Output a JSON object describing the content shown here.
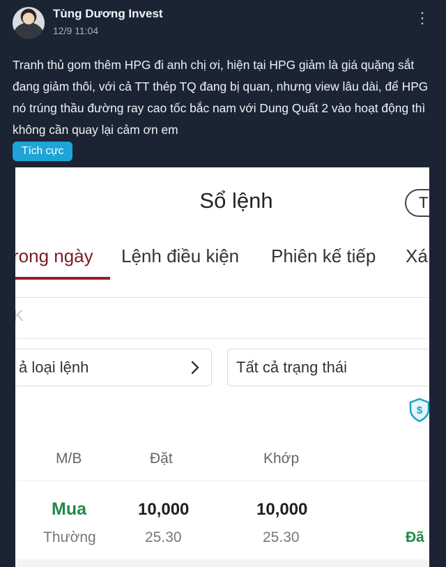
{
  "post": {
    "author": "Tùng Dương Invest",
    "timestamp": "12/9 11:04",
    "more_icon": "more-horizontal-icon",
    "text": "Tranh thủ gom thêm HPG đi anh chị ơi, hiện tại HPG giảm là giá quặng sắt đang giảm thôi, với cả TT thép TQ đang bị quan, nhưng view lâu dài, để HPG nó trúng thầu đường ray cao tốc bắc nam với Dung Quất 2 vào hoạt động thì không cần quay lại cảm ơn em",
    "tag": "Tích cực",
    "tag_color": "#1ea4d8"
  },
  "screenshot": {
    "title": "Sổ lệnh",
    "pill_button": "T",
    "tabs": [
      {
        "label": "rong ngày",
        "active": true
      },
      {
        "label": "Lệnh điều kiện"
      },
      {
        "label": "Phiên kế tiếp"
      },
      {
        "label": "Xá"
      }
    ],
    "search_placeholder": "K",
    "filters": {
      "order_type": "ả loại lệnh",
      "status": "Tất cả trạng thái"
    },
    "shield_icon": "shield-dollar-icon",
    "columns": [
      "M/B",
      "Đặt",
      "Khớp"
    ],
    "orders": [
      {
        "side": "Mua",
        "type": "Thường",
        "placed_qty": "10,000",
        "placed_price": "25.30",
        "matched_qty": "10,000",
        "matched_price": "25.30",
        "status": "Đã"
      }
    ],
    "accent_color": "#9b1c26",
    "buy_color": "#1e8b4a"
  }
}
